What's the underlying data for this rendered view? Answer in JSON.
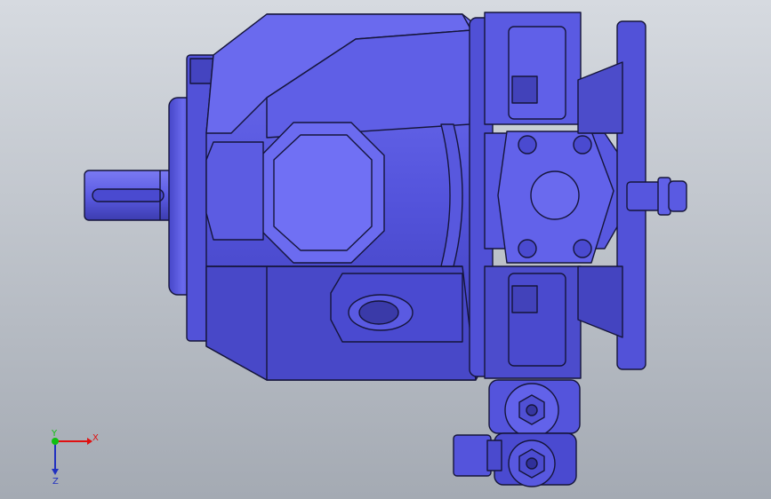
{
  "viewport": {
    "background_top": "#d6dae0",
    "background_bottom": "#a9afb8",
    "model_color": "#5a5ae6",
    "edge_color": "#1a1a3a"
  },
  "triad": {
    "x_label": "X",
    "y_label": "Y",
    "z_label": "Z",
    "x_color": "#e01010",
    "y_color": "#10c010",
    "z_color": "#2030c0"
  }
}
